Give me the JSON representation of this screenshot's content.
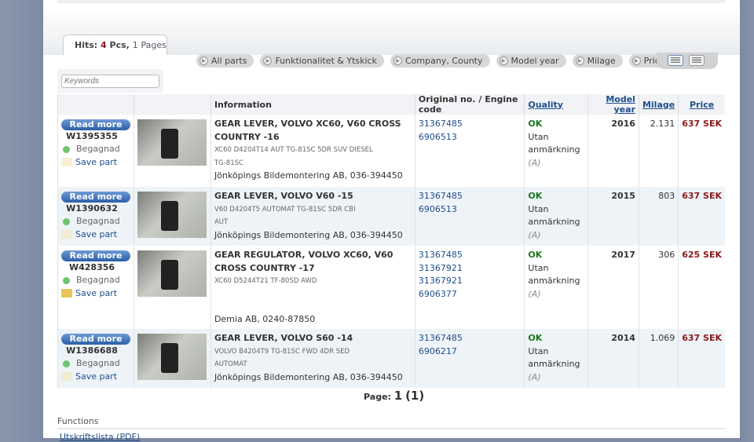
{
  "hits": {
    "label": "Hits:",
    "count": "4",
    "pcs": "Pcs,",
    "pages_count": "1",
    "pages": "Pages"
  },
  "filters": [
    "All parts",
    "Funktionalitet & Ytskick",
    "Company, County",
    "Model year",
    "Milage",
    "Price"
  ],
  "keywords_placeholder": "Keywords",
  "columns": [
    "",
    "",
    "Information",
    "Original no. / Engine code",
    "Quality",
    "Model year",
    "Milage",
    "Price"
  ],
  "rows": [
    {
      "read_more": "Read more",
      "id": "W1395355",
      "condition": "Begagnad",
      "save": "Save part",
      "title": "GEAR LEVER, VOLVO XC60, V60 CROSS COUNTRY -16",
      "sub1": "XC60 D4204T14 AUT TG-81SC 5DR SUV DIESEL",
      "sub2": "TG-81SC",
      "company": "Jönköpings Bildemontering AB, 036-394450",
      "orig": [
        "31367485",
        "6906513"
      ],
      "quality": "OK",
      "quality_text": "Utan anmärkning",
      "grade": "(A)",
      "year": "2016",
      "milage": "2.131",
      "price": "637 SEK"
    },
    {
      "read_more": "Read more",
      "id": "W1390632",
      "condition": "Begagnad",
      "save": "Save part",
      "title": "GEAR LEVER, VOLVO V60 -15",
      "sub1": "V60 D4204T5 AUTOMAT TG-81SC 5DR CBI",
      "sub2": "AUT",
      "company": "Jönköpings Bildemontering AB, 036-394450",
      "orig": [
        "31367485",
        "6906513"
      ],
      "quality": "OK",
      "quality_text": "Utan anmärkning",
      "grade": "(A)",
      "year": "2015",
      "milage": "803",
      "price": "637 SEK"
    },
    {
      "read_more": "Read more",
      "id": "W428356",
      "condition": "Begagnad",
      "save": "Save part",
      "title": "GEAR REGULATOR, VOLVO XC60, V60 CROSS COUNTRY -17",
      "sub1": "XC60 D5244T21 TF-80SD AWD",
      "sub2": "",
      "company": "Demia AB, 0240-87850",
      "orig": [
        "31367485",
        "31367921",
        "31367921",
        "6906377"
      ],
      "quality": "OK",
      "quality_text": "Utan anmärkning",
      "grade": "(A)",
      "year": "2017",
      "milage": "306",
      "price": "625 SEK"
    },
    {
      "read_more": "Read more",
      "id": "W1386688",
      "condition": "Begagnad",
      "save": "Save part",
      "title": "GEAR LEVER, VOLVO S60 -14",
      "sub1": "VOLVO B4204T9 TG-81SC FWD 4DR SED",
      "sub2": "AUTOMAT",
      "company": "Jönköpings Bildemontering AB, 036-394450",
      "orig": [
        "31367485",
        "6906217"
      ],
      "quality": "OK",
      "quality_text": "Utan anmärkning",
      "grade": "(A)",
      "year": "2014",
      "milage": "1.069",
      "price": "637 SEK"
    }
  ],
  "pager": {
    "label": "Page:",
    "current": "1",
    "total": "(1)"
  },
  "functions": {
    "title": "Functions",
    "pdf": "Utskriftslista (PDF)"
  }
}
